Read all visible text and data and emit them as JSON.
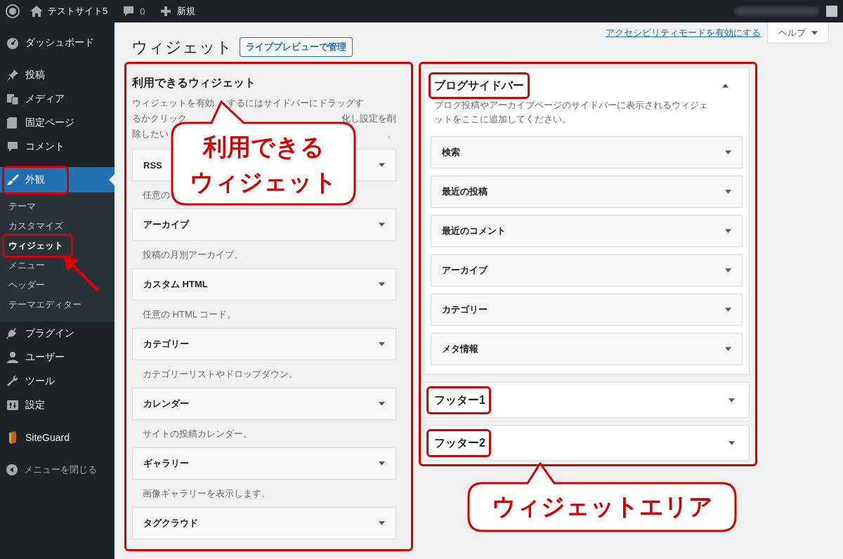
{
  "admin_bar": {
    "site_name": "テストサイト5",
    "comments_count": "0",
    "new_label": "新規"
  },
  "sidebar": {
    "sections": [
      [
        {
          "label": "ダッシュボード",
          "selected": false
        }
      ],
      [
        {
          "label": "投稿",
          "selected": false
        },
        {
          "label": "メディア",
          "selected": false
        },
        {
          "label": "固定ページ",
          "selected": false
        },
        {
          "label": "コメント",
          "selected": false
        }
      ],
      [
        {
          "label": "外観",
          "selected": true,
          "highlighted": true,
          "children": [
            {
              "label": "テーマ",
              "selected": false,
              "highlighted": false
            },
            {
              "label": "カスタマイズ",
              "selected": false,
              "highlighted": false
            },
            {
              "label": "ウィジェット",
              "selected": true,
              "highlighted": true
            },
            {
              "label": "メニュー",
              "selected": false,
              "highlighted": false
            },
            {
              "label": "ヘッダー",
              "selected": false,
              "highlighted": false
            },
            {
              "label": "テーマエディター",
              "selected": false,
              "highlighted": false
            }
          ]
        },
        {
          "label": "プラグイン",
          "selected": false
        },
        {
          "label": "ユーザー",
          "selected": false
        },
        {
          "label": "ツール",
          "selected": false
        },
        {
          "label": "設定",
          "selected": false
        }
      ],
      [
        {
          "label": "SiteGuard",
          "selected": false
        }
      ]
    ],
    "collapse_label": "メニューを閉じる"
  },
  "screen_meta": {
    "accessibility_link": "アクセシビリティモードを有効にする",
    "help_button": "ヘルプ"
  },
  "page": {
    "title": "ウィジェット",
    "action_button": "ライブプレビューで管理"
  },
  "available_widgets": {
    "title": "利用できるウィジェット",
    "description_lines": [
      [
        "ウィジェットを有効",
        "するにはサイドバーにドラッグす"
      ],
      [
        "るかクリック",
        "化し設定を削"
      ],
      [
        "除したい",
        "。"
      ]
    ],
    "widgets": [
      {
        "name": "RSS",
        "description": "任意の"
      },
      {
        "name": "アーカイブ",
        "description": "投稿の月別アーカイブ。"
      },
      {
        "name": "カスタム HTML",
        "description": "任意の HTML コード。"
      },
      {
        "name": "カテゴリー",
        "description": "カテゴリーリストやドロップダウン。"
      },
      {
        "name": "カレンダー",
        "description": "サイトの投稿カレンダー。"
      },
      {
        "name": "ギャラリー",
        "description": "画像ギャラリーを表示します。"
      },
      {
        "name": "タグクラウド"
      }
    ]
  },
  "widget_areas": [
    {
      "name": "ブログサイドバー",
      "expanded": true,
      "description": "ブログ投稿やアーカイブページのサイドバーに表示されるウィジェットをここに追加してください。",
      "widgets": [
        {
          "name": "検索"
        },
        {
          "name": "最近の投稿"
        },
        {
          "name": "最近のコメント"
        },
        {
          "name": "アーカイブ"
        },
        {
          "name": "カテゴリー"
        },
        {
          "name": "メタ情報"
        }
      ]
    },
    {
      "name": "フッター1",
      "expanded": false
    },
    {
      "name": "フッター2",
      "expanded": false
    }
  ],
  "callouts": [
    {
      "lines": [
        "利用できる",
        "ウィジェット"
      ]
    },
    {
      "lines": [
        "ウィジェットエリア"
      ]
    }
  ]
}
